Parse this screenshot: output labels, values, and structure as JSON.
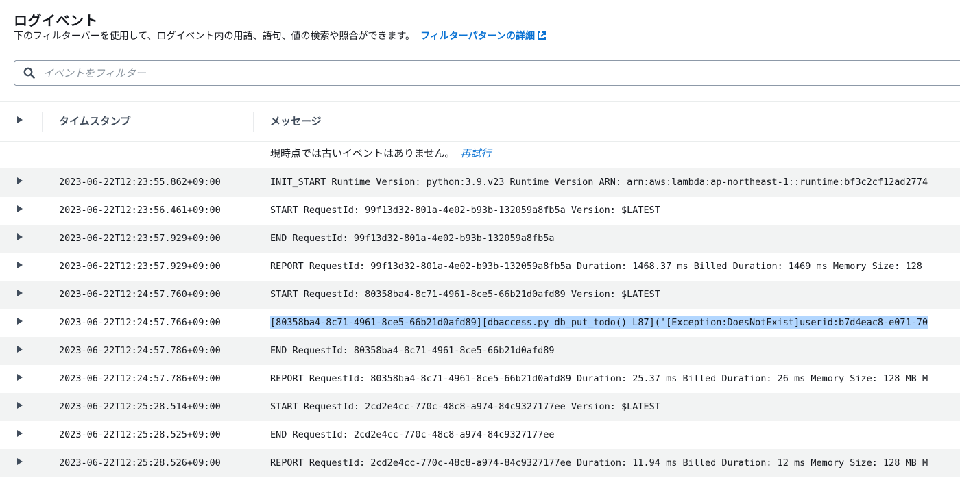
{
  "header": {
    "title": "ログイベント",
    "description": "下のフィルターバーを使用して、ログイベント内の用語、語句、値の検索や照合ができます。",
    "link_label": "フィルターパターンの詳細"
  },
  "search": {
    "placeholder": "イベントをフィルター",
    "value": ""
  },
  "table": {
    "columns": [
      "タイムスタンプ",
      "メッセージ"
    ],
    "notice": "現時点では古いイベントはありません。",
    "retry_label": "再試行",
    "rows": [
      {
        "timestamp": "2023-06-22T12:23:55.862+09:00",
        "message": "INIT_START Runtime Version: python:3.9.v23 Runtime Version ARN: arn:aws:lambda:ap-northeast-1::runtime:bf3c2cf12ad2774"
      },
      {
        "timestamp": "2023-06-22T12:23:56.461+09:00",
        "message": "START RequestId: 99f13d32-801a-4e02-b93b-132059a8fb5a Version: $LATEST"
      },
      {
        "timestamp": "2023-06-22T12:23:57.929+09:00",
        "message": "END RequestId: 99f13d32-801a-4e02-b93b-132059a8fb5a"
      },
      {
        "timestamp": "2023-06-22T12:23:57.929+09:00",
        "message": "REPORT RequestId: 99f13d32-801a-4e02-b93b-132059a8fb5a Duration: 1468.37 ms Billed Duration: 1469 ms Memory Size: 128"
      },
      {
        "timestamp": "2023-06-22T12:24:57.760+09:00",
        "message": "START RequestId: 80358ba4-8c71-4961-8ce5-66b21d0afd89 Version: $LATEST"
      },
      {
        "timestamp": "2023-06-22T12:24:57.766+09:00",
        "message": "[80358ba4-8c71-4961-8ce5-66b21d0afd89][dbaccess.py db_put_todo() L87]('[Exception:DoesNotExist]userid:b7d4eac8-e071-70",
        "selected": true
      },
      {
        "timestamp": "2023-06-22T12:24:57.786+09:00",
        "message": "END RequestId: 80358ba4-8c71-4961-8ce5-66b21d0afd89"
      },
      {
        "timestamp": "2023-06-22T12:24:57.786+09:00",
        "message": "REPORT RequestId: 80358ba4-8c71-4961-8ce5-66b21d0afd89 Duration: 25.37 ms Billed Duration: 26 ms Memory Size: 128 MB M"
      },
      {
        "timestamp": "2023-06-22T12:25:28.514+09:00",
        "message": "START RequestId: 2cd2e4cc-770c-48c8-a974-84c9327177ee Version: $LATEST"
      },
      {
        "timestamp": "2023-06-22T12:25:28.525+09:00",
        "message": "END RequestId: 2cd2e4cc-770c-48c8-a974-84c9327177ee"
      },
      {
        "timestamp": "2023-06-22T12:25:28.526+09:00",
        "message": "REPORT RequestId: 2cd2e4cc-770c-48c8-a974-84c9327177ee Duration: 11.94 ms Billed Duration: 12 ms Memory Size: 128 MB M"
      }
    ]
  },
  "colors": {
    "link": "#0972d3",
    "row_shade": "#f2f3f3",
    "selection": "#b3d7ff"
  },
  "icons": {
    "external_link": "external-link-icon",
    "search": "search-icon",
    "expand": "caret-right-icon"
  }
}
